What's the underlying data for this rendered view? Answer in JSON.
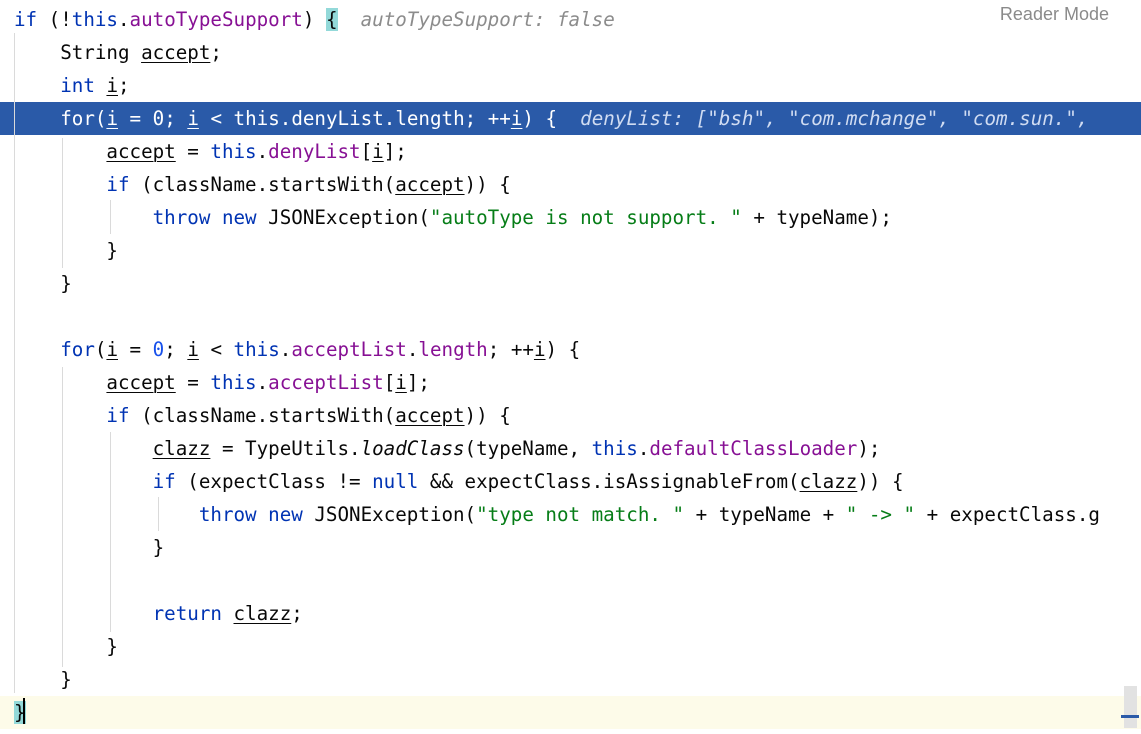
{
  "editor": {
    "reader_mode_label": "Reader Mode",
    "lines": [
      {
        "tokens": [
          {
            "t": "if",
            "c": "kw"
          },
          {
            "t": " (!"
          },
          {
            "t": "this",
            "c": "kw"
          },
          {
            "t": "."
          },
          {
            "t": "autoTypeSupport",
            "c": "field"
          },
          {
            "t": ") "
          },
          {
            "t": "{",
            "c": "bracket"
          },
          {
            "t": "  autoTypeSupport: false",
            "c": "hint"
          }
        ]
      },
      {
        "tokens": [
          {
            "t": "    String "
          },
          {
            "t": "accept",
            "c": "u"
          },
          {
            "t": ";"
          }
        ]
      },
      {
        "tokens": [
          {
            "t": "    "
          },
          {
            "t": "int",
            "c": "kw"
          },
          {
            "t": " "
          },
          {
            "t": "i",
            "c": "u"
          },
          {
            "t": ";"
          }
        ]
      },
      {
        "highlight": true,
        "tokens": [
          {
            "t": "    "
          },
          {
            "t": "for",
            "c": "kw"
          },
          {
            "t": "("
          },
          {
            "t": "i",
            "c": "u"
          },
          {
            "t": " = "
          },
          {
            "t": "0",
            "c": "num"
          },
          {
            "t": "; "
          },
          {
            "t": "i",
            "c": "u"
          },
          {
            "t": " < "
          },
          {
            "t": "this",
            "c": "kw"
          },
          {
            "t": "."
          },
          {
            "t": "denyList",
            "c": "field"
          },
          {
            "t": "."
          },
          {
            "t": "length",
            "c": "field"
          },
          {
            "t": "; ++"
          },
          {
            "t": "i",
            "c": "u"
          },
          {
            "t": ") {  "
          },
          {
            "t": "denyList: [\"bsh\", \"com.mchange\", \"com.sun.\",",
            "c": "hint"
          }
        ]
      },
      {
        "tokens": [
          {
            "t": "        "
          },
          {
            "t": "accept",
            "c": "u"
          },
          {
            "t": " = "
          },
          {
            "t": "this",
            "c": "kw"
          },
          {
            "t": "."
          },
          {
            "t": "denyList",
            "c": "field"
          },
          {
            "t": "["
          },
          {
            "t": "i",
            "c": "u"
          },
          {
            "t": "];"
          }
        ]
      },
      {
        "tokens": [
          {
            "t": "        "
          },
          {
            "t": "if",
            "c": "kw"
          },
          {
            "t": " (className.startsWith("
          },
          {
            "t": "accept",
            "c": "u"
          },
          {
            "t": ")) {"
          }
        ]
      },
      {
        "tokens": [
          {
            "t": "            "
          },
          {
            "t": "throw",
            "c": "kw"
          },
          {
            "t": " "
          },
          {
            "t": "new",
            "c": "kw"
          },
          {
            "t": " JSONException("
          },
          {
            "t": "\"autoType is not support. \"",
            "c": "str"
          },
          {
            "t": " + typeName);"
          }
        ]
      },
      {
        "tokens": [
          {
            "t": "        }"
          }
        ]
      },
      {
        "tokens": [
          {
            "t": "    }"
          }
        ]
      },
      {
        "tokens": [
          {
            "t": ""
          }
        ]
      },
      {
        "tokens": [
          {
            "t": "    "
          },
          {
            "t": "for",
            "c": "kw"
          },
          {
            "t": "("
          },
          {
            "t": "i",
            "c": "u"
          },
          {
            "t": " = "
          },
          {
            "t": "0",
            "c": "num"
          },
          {
            "t": "; "
          },
          {
            "t": "i",
            "c": "u"
          },
          {
            "t": " < "
          },
          {
            "t": "this",
            "c": "kw"
          },
          {
            "t": "."
          },
          {
            "t": "acceptList",
            "c": "field"
          },
          {
            "t": "."
          },
          {
            "t": "length",
            "c": "field"
          },
          {
            "t": "; ++"
          },
          {
            "t": "i",
            "c": "u"
          },
          {
            "t": ") {"
          }
        ]
      },
      {
        "tokens": [
          {
            "t": "        "
          },
          {
            "t": "accept",
            "c": "u"
          },
          {
            "t": " = "
          },
          {
            "t": "this",
            "c": "kw"
          },
          {
            "t": "."
          },
          {
            "t": "acceptList",
            "c": "field"
          },
          {
            "t": "["
          },
          {
            "t": "i",
            "c": "u"
          },
          {
            "t": "];"
          }
        ]
      },
      {
        "tokens": [
          {
            "t": "        "
          },
          {
            "t": "if",
            "c": "kw"
          },
          {
            "t": " (className.startsWith("
          },
          {
            "t": "accept",
            "c": "u"
          },
          {
            "t": ")) {"
          }
        ]
      },
      {
        "tokens": [
          {
            "t": "            "
          },
          {
            "t": "clazz",
            "c": "u"
          },
          {
            "t": " = TypeUtils."
          },
          {
            "t": "loadClass",
            "c": "fn"
          },
          {
            "t": "(typeName, "
          },
          {
            "t": "this",
            "c": "kw"
          },
          {
            "t": "."
          },
          {
            "t": "defaultClassLoader",
            "c": "field"
          },
          {
            "t": ");"
          }
        ]
      },
      {
        "tokens": [
          {
            "t": "            "
          },
          {
            "t": "if",
            "c": "kw"
          },
          {
            "t": " (expectClass != "
          },
          {
            "t": "null",
            "c": "kw"
          },
          {
            "t": " && expectClass.isAssignableFrom("
          },
          {
            "t": "clazz",
            "c": "u"
          },
          {
            "t": ")) {"
          }
        ]
      },
      {
        "tokens": [
          {
            "t": "                "
          },
          {
            "t": "throw",
            "c": "kw"
          },
          {
            "t": " "
          },
          {
            "t": "new",
            "c": "kw"
          },
          {
            "t": " JSONException("
          },
          {
            "t": "\"type not match. \"",
            "c": "str"
          },
          {
            "t": " + typeName + "
          },
          {
            "t": "\" -> \"",
            "c": "str"
          },
          {
            "t": " + expectClass.g"
          }
        ]
      },
      {
        "tokens": [
          {
            "t": "            }"
          }
        ]
      },
      {
        "tokens": [
          {
            "t": ""
          }
        ]
      },
      {
        "tokens": [
          {
            "t": "            "
          },
          {
            "t": "return",
            "c": "kw"
          },
          {
            "t": " "
          },
          {
            "t": "clazz",
            "c": "u"
          },
          {
            "t": ";"
          }
        ]
      },
      {
        "tokens": [
          {
            "t": "        }"
          }
        ]
      },
      {
        "tokens": [
          {
            "t": "    }"
          }
        ]
      },
      {
        "current": true,
        "tokens": [
          {
            "t": "}",
            "c": "bracket"
          }
        ]
      }
    ]
  }
}
